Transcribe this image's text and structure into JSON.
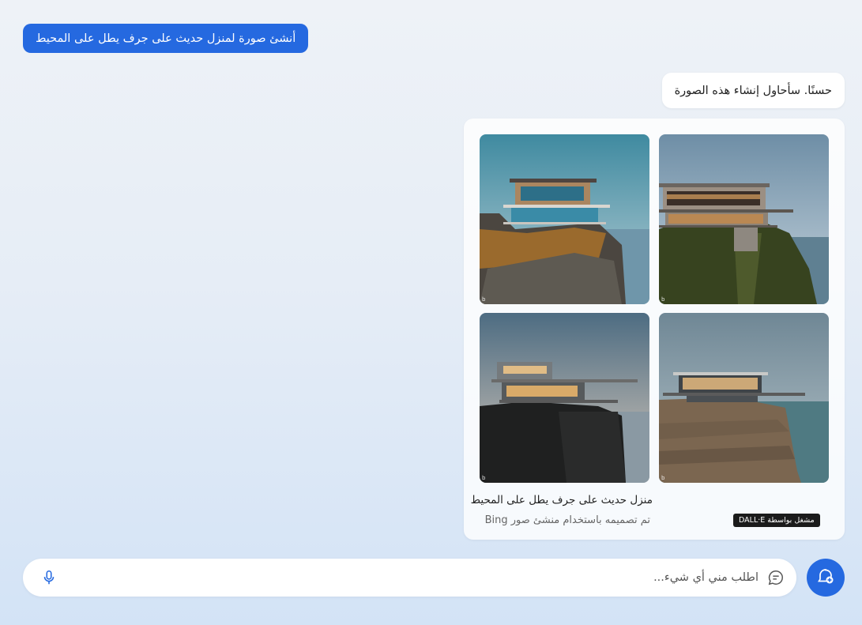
{
  "user_message": "أنشئ صورة لمنزل حديث على جرف يطل على المحيط",
  "bot_message": "حسنًا. سأحاول إنشاء هذه الصورة",
  "image_card": {
    "title": "منزل حديث على جرف يطل على المحيط",
    "subtitle": "تم تصميمه باستخدام منشئ صور Bing",
    "badge": "مشغل بواسطة DALL·E",
    "watermark": "b"
  },
  "input": {
    "placeholder": "اطلب مني أي شيء..."
  },
  "colors": {
    "accent": "#2569e0"
  }
}
